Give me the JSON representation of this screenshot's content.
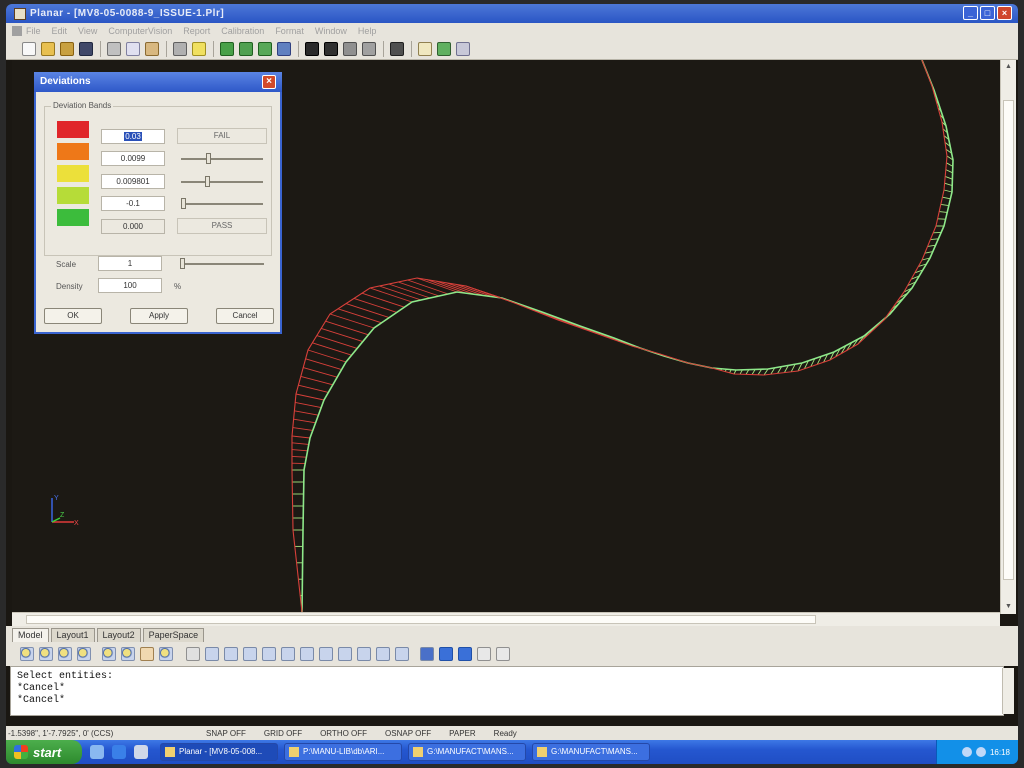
{
  "window": {
    "title": "Planar - [MV8-05-0088-9_ISSUE-1.Plr]",
    "controls": [
      "_",
      "□",
      "×"
    ]
  },
  "menu": [
    "File",
    "Edit",
    "View",
    "ComputerVision",
    "Report",
    "Calibration",
    "Format",
    "Window",
    "Help"
  ],
  "dialog": {
    "title": "Deviations",
    "close": "×",
    "group_label": "Deviation Bands",
    "bands": [
      {
        "color": "#e0262a",
        "value": "0.03",
        "tag": "FAIL",
        "slider": null
      },
      {
        "color": "#ee7818",
        "value": "0.0099",
        "tag": null,
        "slider": 0.33
      },
      {
        "color": "#ece03a",
        "value": "0.009801",
        "tag": null,
        "slider": 0.32
      },
      {
        "color": "#b6dc38",
        "value": "-0.1",
        "tag": null,
        "slider": 0.0
      },
      {
        "color": "#3cbc3c",
        "value": "0.000",
        "tag": "PASS",
        "slider": null
      }
    ],
    "scale_label": "Scale",
    "scale_value": "1",
    "scale_slider": 0.0,
    "density_label": "Density",
    "density_value": "100",
    "density_unit": "%",
    "buttons": {
      "ok": "OK",
      "apply": "Apply",
      "cancel": "Cancel"
    }
  },
  "ucs": {
    "y": "Y",
    "z": "Z",
    "x": "X"
  },
  "layout_tabs": [
    {
      "label": "Model",
      "active": true
    },
    {
      "label": "Layout1",
      "active": false
    },
    {
      "label": "Layout2",
      "active": false
    },
    {
      "label": "PaperSpace",
      "active": false
    }
  ],
  "command": {
    "lines": [
      "Select entities:",
      "*Cancel*",
      "*Cancel*"
    ]
  },
  "status": {
    "coords": "-1.5398\", 1'-7.7925\", 0' (CCS)",
    "items": [
      "SNAP OFF",
      "GRID OFF",
      "ORTHO OFF",
      "OSNAP OFF",
      "PAPER",
      "Ready"
    ]
  },
  "taskbar": {
    "start": "start",
    "tasks": [
      {
        "label": "Planar - [MV8-05-008...",
        "active": true
      },
      {
        "label": "P:\\MANU-LIB\\db\\ARI...",
        "active": false
      },
      {
        "label": "G:\\MANUFACT\\MANS...",
        "active": false
      },
      {
        "label": "G:\\MANUFACT\\MANS...",
        "active": false
      }
    ],
    "clock": "16:18"
  },
  "colors": {
    "profile_line": "#8ee88a",
    "fail_whisker": "#d8403a",
    "pass_whisker": "#a8e880",
    "viewport_bg": "#1c1914"
  }
}
